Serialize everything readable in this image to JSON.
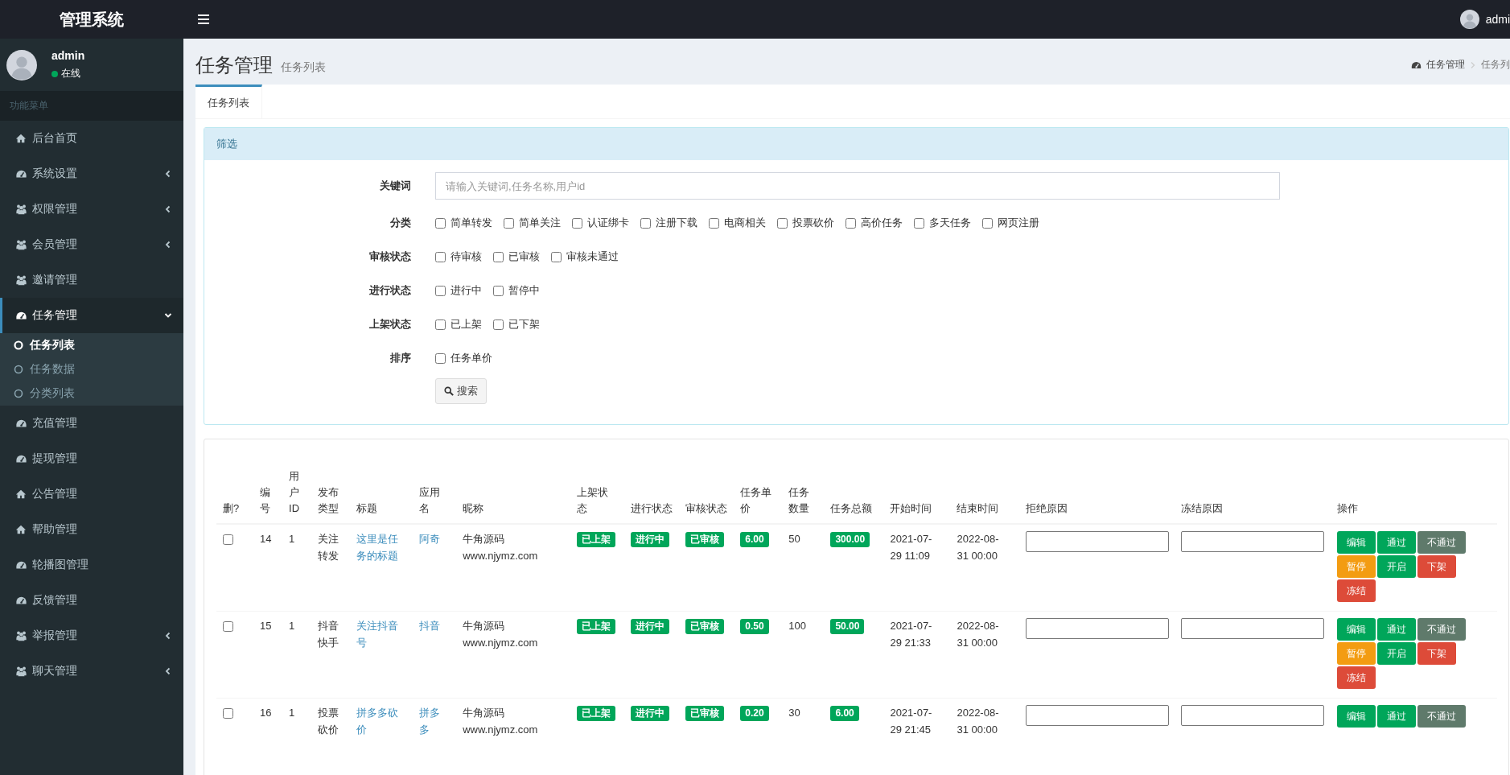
{
  "topbar": {
    "logo": "管理系统",
    "user": "admi"
  },
  "sidebar": {
    "user": {
      "name": "admin",
      "status": "在线",
      "online": true
    },
    "menu_header": "功能菜单",
    "items": [
      {
        "label": "后台首页",
        "kind": "link",
        "selected": false
      },
      {
        "label": "系统设置",
        "kind": "tree",
        "expanded": false,
        "selected": false
      },
      {
        "label": "权限管理",
        "kind": "tree",
        "expanded": false,
        "selected": false
      },
      {
        "label": "会员管理",
        "kind": "tree",
        "expanded": false,
        "selected": false
      },
      {
        "label": "邀请管理",
        "kind": "link",
        "selected": false
      },
      {
        "label": "任务管理",
        "kind": "tree",
        "expanded": true,
        "selected": true,
        "children": [
          {
            "label": "任务列表",
            "selected": true
          },
          {
            "label": "任务数据",
            "selected": false
          },
          {
            "label": "分类列表",
            "selected": false
          }
        ]
      },
      {
        "label": "充值管理",
        "kind": "link",
        "selected": false
      },
      {
        "label": "提现管理",
        "kind": "link",
        "selected": false
      },
      {
        "label": "公告管理",
        "kind": "link",
        "selected": false
      },
      {
        "label": "帮助管理",
        "kind": "link",
        "selected": false
      },
      {
        "label": "轮播图管理",
        "kind": "link",
        "selected": false
      },
      {
        "label": "反馈管理",
        "kind": "link",
        "selected": false
      },
      {
        "label": "举报管理",
        "kind": "tree",
        "expanded": false,
        "selected": false
      },
      {
        "label": "聊天管理",
        "kind": "tree",
        "expanded": false,
        "selected": false
      }
    ]
  },
  "content_header": {
    "title": "任务管理",
    "subtitle": "任务列表",
    "breadcrumb": [
      "任务管理",
      "任务列"
    ]
  },
  "tabs": [
    {
      "label": "任务列表",
      "selected": true
    }
  ],
  "filter": {
    "title": "筛选",
    "fields": [
      {
        "label": "关键词",
        "kind": "text",
        "placeholder": "请输入关键词,任务名称,用户id"
      },
      {
        "label": "分类",
        "kind": "checks",
        "options": [
          {
            "label": "简单转发",
            "checked": false
          },
          {
            "label": "简单关注",
            "checked": false
          },
          {
            "label": "认证绑卡",
            "checked": false
          },
          {
            "label": "注册下载",
            "checked": false
          },
          {
            "label": "电商相关",
            "checked": false
          },
          {
            "label": "投票砍价",
            "checked": false
          },
          {
            "label": "高价任务",
            "checked": false
          },
          {
            "label": "多天任务",
            "checked": false
          },
          {
            "label": "网页注册",
            "checked": false
          }
        ]
      },
      {
        "label": "审核状态",
        "kind": "checks",
        "options": [
          {
            "label": "待审核",
            "checked": false
          },
          {
            "label": "已审核",
            "checked": false
          },
          {
            "label": "审核未通过",
            "checked": false
          }
        ]
      },
      {
        "label": "进行状态",
        "kind": "checks",
        "options": [
          {
            "label": "进行中",
            "checked": false
          },
          {
            "label": "暂停中",
            "checked": false
          }
        ]
      },
      {
        "label": "上架状态",
        "kind": "checks",
        "options": [
          {
            "label": "已上架",
            "checked": false
          },
          {
            "label": "已下架",
            "checked": false
          }
        ]
      },
      {
        "label": "排序",
        "kind": "checks",
        "options": [
          {
            "label": "任务单价",
            "checked": false
          }
        ]
      }
    ],
    "search_button": "搜索"
  },
  "table": {
    "columns": [
      "删?",
      "编号",
      "用户ID",
      "发布类型",
      "标题",
      "应用名",
      "昵称",
      "上架状态",
      "进行状态",
      "审核状态",
      "任务单价",
      "任务数量",
      "任务总额",
      "开始时间",
      "结束时间",
      "拒绝原因",
      "冻结原因",
      "操作"
    ],
    "rows": [
      {
        "checked": false,
        "id": "14",
        "user_id": "1",
        "type": "关注转发",
        "title": "这里是任务的标题",
        "app": "阿奇",
        "nickname": "牛角源码 www.njymz.com",
        "shelf_status": "已上架",
        "run_status": "进行中",
        "review_status": "已审核",
        "unit_price": "6.00",
        "quantity": "50",
        "total": "300.00",
        "start_time": "2021-07-29 11:09",
        "end_time": "2022-08-31 00:00",
        "actions": [
          {
            "label": "编辑",
            "kind": "success"
          },
          {
            "label": "通过",
            "kind": "success"
          },
          {
            "label": "不通过",
            "kind": "default"
          },
          {
            "label": "暂停",
            "kind": "warning"
          },
          {
            "label": "开启",
            "kind": "success"
          },
          {
            "label": "下架",
            "kind": "danger"
          },
          {
            "label": "冻结",
            "kind": "danger"
          }
        ]
      },
      {
        "checked": false,
        "id": "15",
        "user_id": "1",
        "type": "抖音快手",
        "title": "关注抖音号",
        "app": "抖音",
        "nickname": "牛角源码 www.njymz.com",
        "shelf_status": "已上架",
        "run_status": "进行中",
        "review_status": "已审核",
        "unit_price": "0.50",
        "quantity": "100",
        "total": "50.00",
        "start_time": "2021-07-29 21:33",
        "end_time": "2022-08-31 00:00",
        "actions": [
          {
            "label": "编辑",
            "kind": "success"
          },
          {
            "label": "通过",
            "kind": "success"
          },
          {
            "label": "不通过",
            "kind": "default"
          },
          {
            "label": "暂停",
            "kind": "warning"
          },
          {
            "label": "开启",
            "kind": "success"
          },
          {
            "label": "下架",
            "kind": "danger"
          },
          {
            "label": "冻结",
            "kind": "danger"
          }
        ]
      },
      {
        "checked": false,
        "id": "16",
        "user_id": "1",
        "type": "投票砍价",
        "title": "拼多多砍价",
        "app": "拼多多",
        "nickname": "牛角源码 www.njymz.com",
        "shelf_status": "已上架",
        "run_status": "进行中",
        "review_status": "已审核",
        "unit_price": "0.20",
        "quantity": "30",
        "total": "6.00",
        "start_time": "2021-07-29 21:45",
        "end_time": "2022-08-31 00:00",
        "actions": [
          {
            "label": "编辑",
            "kind": "success"
          },
          {
            "label": "通过",
            "kind": "success"
          },
          {
            "label": "不通过",
            "kind": "default"
          }
        ]
      }
    ]
  }
}
